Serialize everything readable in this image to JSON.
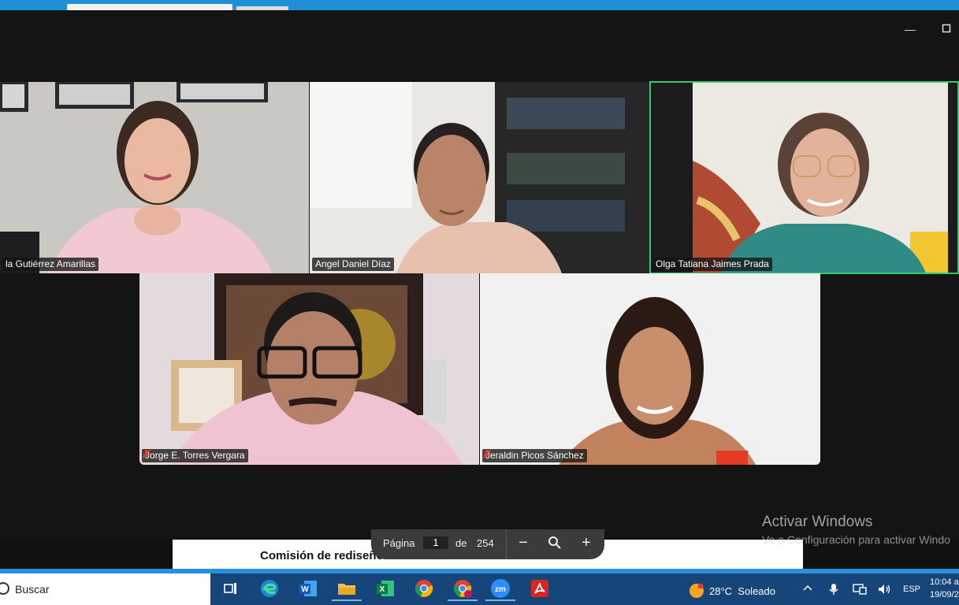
{
  "window": {
    "minimize_icon": "minimize-icon",
    "maximize_icon": "maximize-icon"
  },
  "participants": [
    {
      "name": "la Gutiérrez Amarillas",
      "muted": false,
      "active": false
    },
    {
      "name": "Angel Daniel Díaz",
      "muted": false,
      "active": false
    },
    {
      "name": "Olga Tatiana Jaimes Prada",
      "muted": false,
      "active": true
    },
    {
      "name": "Jorge E. Torres Vergara",
      "muted": true,
      "active": false
    },
    {
      "name": "Jeraldin Picos Sánchez",
      "muted": true,
      "active": false
    }
  ],
  "pdf": {
    "page_label": "Página",
    "page_number": "1",
    "of_label": "de",
    "total_pages": "254",
    "document_heading": "Comisión de rediseño curricular"
  },
  "watermark": {
    "title": "Activar Windows",
    "subtitle": "Ve a Configuración para activar Windo"
  },
  "taskbar": {
    "search_placeholder": "Buscar",
    "apps": [
      "task-view-icon",
      "edge-icon",
      "word-icon",
      "file-explorer-icon",
      "excel-icon",
      "chrome-icon",
      "chrome-profile-icon",
      "zoom-icon",
      "acrobat-icon"
    ],
    "weather": {
      "temp": "28°C",
      "condition": "Soleado"
    },
    "language": "ESP",
    "time": "10:04 a",
    "date": "19/09/2"
  },
  "colors": {
    "active_speaker": "#2ecc71",
    "taskbar": "#16457a",
    "mute": "#e0433a"
  }
}
